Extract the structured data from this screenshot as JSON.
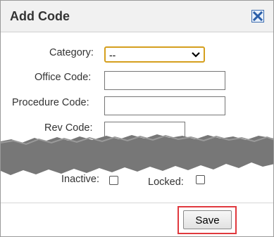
{
  "dialog": {
    "title": "Add Code",
    "close_icon": "close-x-icon"
  },
  "form": {
    "category_label": "Category:",
    "category_value": "--",
    "office_code_label": "Office Code:",
    "office_code_value": "",
    "procedure_code_label": "Procedure Code:",
    "procedure_code_value": "",
    "rev_code_label": "Rev Code:",
    "rev_code_value": "",
    "inactive_label": "Inactive:",
    "locked_label": "Locked:"
  },
  "footer": {
    "save_label": "Save"
  },
  "colors": {
    "select_focus_border": "#d59f1e",
    "highlight": "#e0393e",
    "close_icon": "#3d6db0"
  }
}
